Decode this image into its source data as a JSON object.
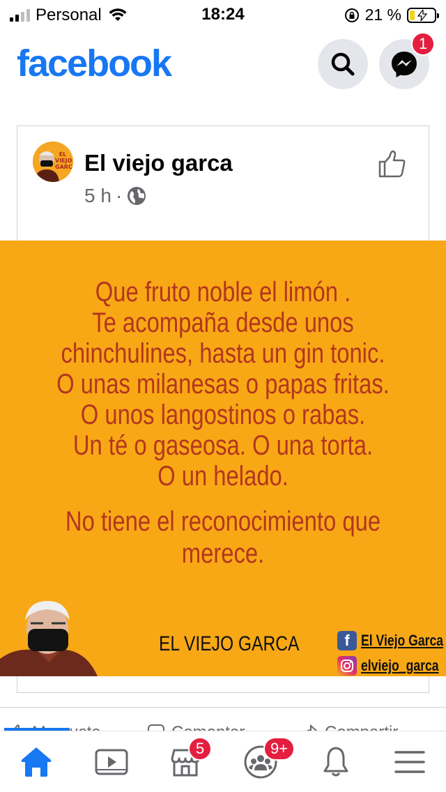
{
  "status_bar": {
    "carrier": "Personal",
    "time": "18:24",
    "battery_percent": "21 %",
    "battery_level": 0.21,
    "signal_bars_active": 2,
    "signal_bars_total": 4
  },
  "header": {
    "logo": "facebook",
    "search_icon": "search-icon",
    "messenger_icon": "messenger-icon",
    "messenger_badge": "1"
  },
  "post": {
    "author": "El viejo garca",
    "time": "5 h",
    "separator": "·",
    "privacy_icon": "globe-icon",
    "like_icon": "thumbs-up-icon",
    "avatar_text": "EL VIEJO GARCA",
    "image": {
      "lines": [
        "Que fruto noble el limón .",
        "Te acompaña desde unos",
        "chinchulines, hasta un gin tonic.",
        "O unas milanesas o papas fritas.",
        "O unos langostinos o rabas.",
        "Un té o gaseosa. O una torta.",
        "O un helado."
      ],
      "closing_lines": [
        "No tiene el reconocimiento que",
        "merece."
      ],
      "brand": "EL VIEJO GARCA",
      "facebook_handle": "El Viejo Garca",
      "instagram_handle": "elviejo_garca",
      "background_color": "#f8a815",
      "text_color": "#b3361f"
    },
    "actions": {
      "like": "Me gusta",
      "comment": "Comentar",
      "share": "Compartir"
    }
  },
  "tab_bar": {
    "marketplace_badge": "5",
    "groups_badge": "9+"
  },
  "colors": {
    "brand_blue": "#1877f2",
    "badge_red": "#e41e3f"
  }
}
